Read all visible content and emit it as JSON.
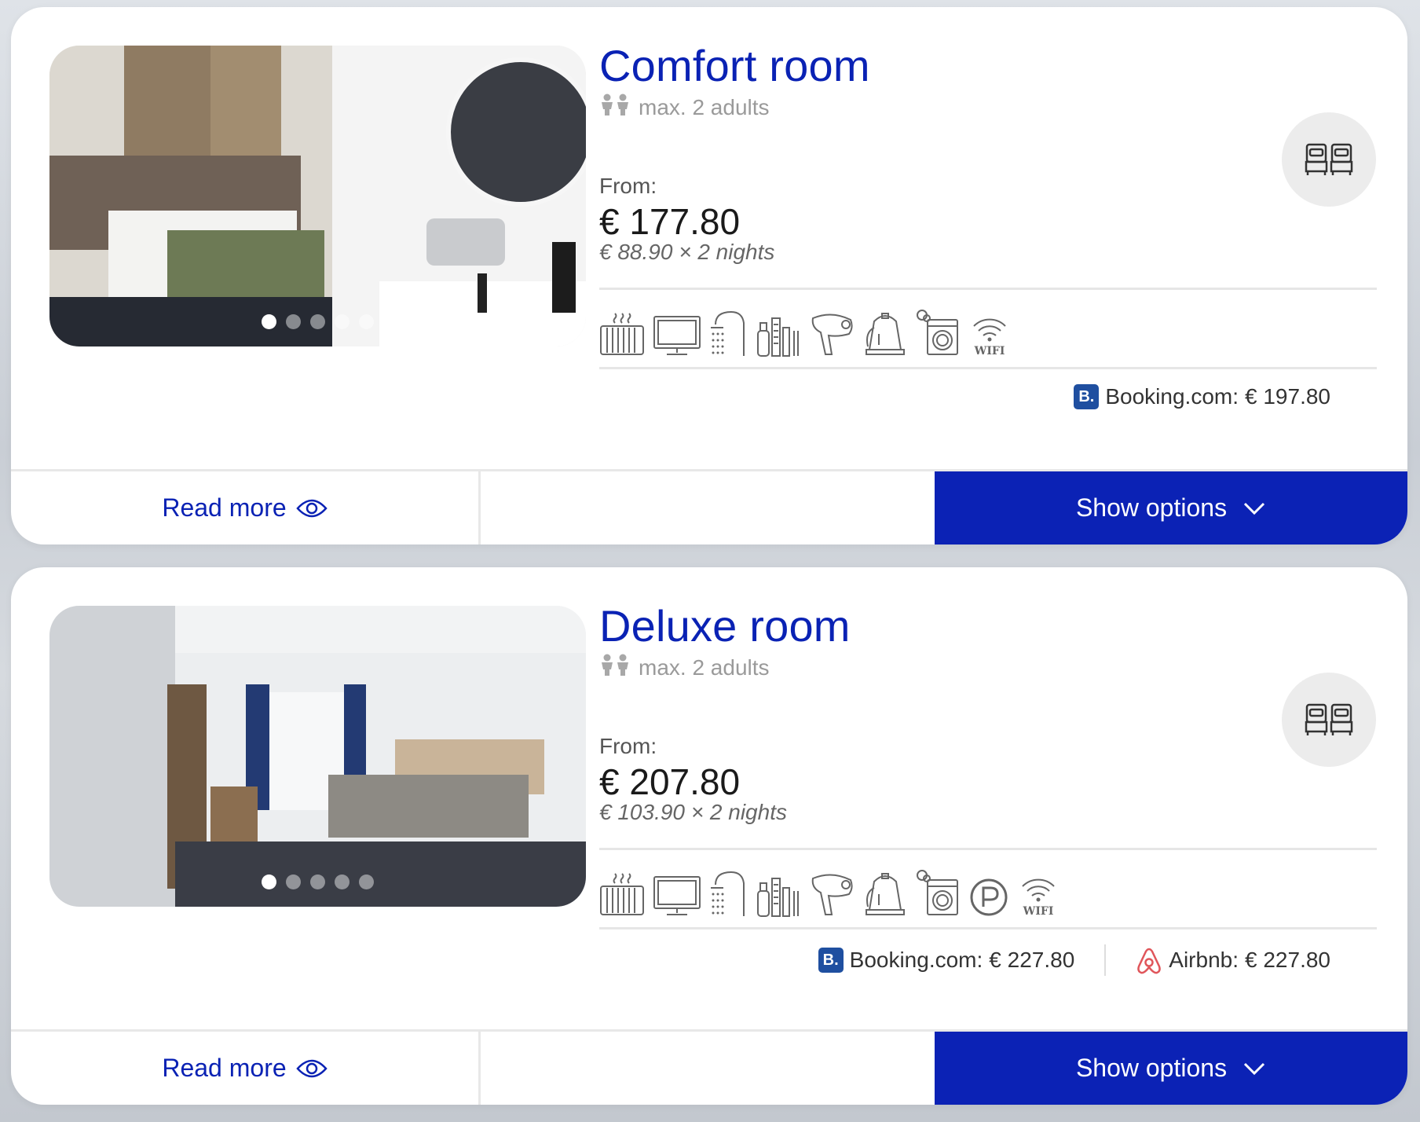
{
  "colors": {
    "brand_blue": "#0b22b5",
    "title_blue": "#0a22b4",
    "muted_gray": "#9a9a9a"
  },
  "rooms": [
    {
      "title": "Comfort room",
      "capacity": "max. 2 adults",
      "from_label": "From:",
      "price": "€ 177.80",
      "nightly": "€ 88.90 × 2 nights",
      "photo_dots": 5,
      "active_dot": 1,
      "amenity_icons": [
        "radiator-icon",
        "tv-icon",
        "shower-icon",
        "toiletries-icon",
        "hairdryer-icon",
        "kettle-icon",
        "washing-machine-icon",
        "wifi-icon"
      ],
      "wifi_label": "WIFI",
      "partners": [
        {
          "name": "Booking.com:",
          "price": "€ 197.80",
          "logo": "B.",
          "icon": "booking-logo-icon"
        }
      ],
      "read_more": "Read more",
      "show_options": "Show options"
    },
    {
      "title": "Deluxe room",
      "capacity": "max. 2 adults",
      "from_label": "From:",
      "price": "€ 207.80",
      "nightly": "€ 103.90 × 2 nights",
      "photo_dots": 5,
      "active_dot": 1,
      "amenity_icons": [
        "radiator-icon",
        "tv-icon",
        "shower-icon",
        "toiletries-icon",
        "hairdryer-icon",
        "kettle-icon",
        "washing-machine-icon",
        "parking-icon",
        "wifi-icon"
      ],
      "wifi_label": "WIFI",
      "partners": [
        {
          "name": "Booking.com:",
          "price": "€ 227.80",
          "logo": "B.",
          "icon": "booking-logo-icon"
        },
        {
          "name": "Airbnb:",
          "price": "€ 227.80",
          "icon": "airbnb-logo-icon"
        }
      ],
      "read_more": "Read more",
      "show_options": "Show options"
    }
  ]
}
